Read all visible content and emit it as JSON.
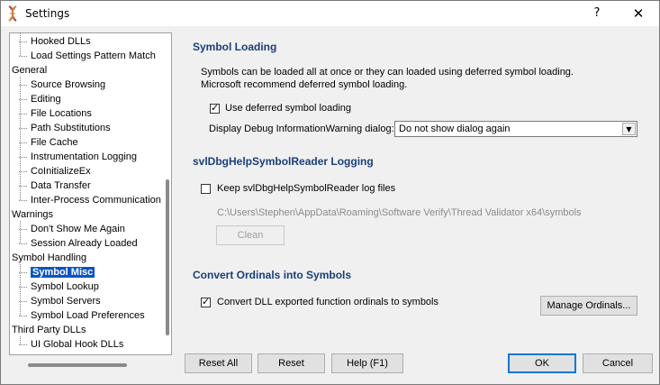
{
  "window": {
    "title": "Settings",
    "help_glyph": "?",
    "close_glyph": "✕"
  },
  "tree": {
    "items": [
      {
        "label": "Hooked DLLs",
        "level": 1
      },
      {
        "label": "Load Settings Pattern Match",
        "level": 1
      },
      {
        "label": "General",
        "level": 0
      },
      {
        "label": "Source Browsing",
        "level": 1
      },
      {
        "label": "Editing",
        "level": 1
      },
      {
        "label": "File Locations",
        "level": 1
      },
      {
        "label": "Path Substitutions",
        "level": 1
      },
      {
        "label": "File Cache",
        "level": 1
      },
      {
        "label": "Instrumentation Logging",
        "level": 1
      },
      {
        "label": "CoInitializeEx",
        "level": 1
      },
      {
        "label": "Data Transfer",
        "level": 1
      },
      {
        "label": "Inter-Process Communication",
        "level": 1
      },
      {
        "label": "Warnings",
        "level": 0
      },
      {
        "label": "Don't Show Me Again",
        "level": 1
      },
      {
        "label": "Session Already Loaded",
        "level": 1
      },
      {
        "label": "Symbol Handling",
        "level": 0
      },
      {
        "label": "Symbol Misc",
        "level": 1,
        "selected": true
      },
      {
        "label": "Symbol Lookup",
        "level": 1
      },
      {
        "label": "Symbol Servers",
        "level": 1
      },
      {
        "label": "Symbol Load Preferences",
        "level": 1
      },
      {
        "label": "Third Party DLLs",
        "level": 0
      },
      {
        "label": "UI Global Hook DLLs",
        "level": 1
      }
    ]
  },
  "symbol_loading": {
    "title": "Symbol Loading",
    "desc_line1": "Symbols can be loaded all at once or they can loaded using deferred symbol loading.",
    "desc_line2": "Microsoft recommend deferred symbol loading.",
    "use_deferred_label": "Use deferred symbol loading",
    "use_deferred_checked": true,
    "display_debug_label": "Display Debug InformationWarning dialog:",
    "display_debug_value": "Do not show dialog again"
  },
  "reader_logging": {
    "title": "svlDbgHelpSymbolReader Logging",
    "keep_log_label": "Keep svlDbgHelpSymbolReader log files",
    "keep_log_checked": false,
    "log_path": "C:\\Users\\Stephen\\AppData\\Roaming\\Software Verify\\Thread Validator x64\\symbols",
    "clean_label": "Clean"
  },
  "ordinals": {
    "title": "Convert Ordinals into Symbols",
    "convert_label": "Convert DLL exported function ordinals to symbols",
    "convert_checked": true,
    "manage_label": "Manage Ordinals..."
  },
  "footer": {
    "reset_all": "Reset All",
    "reset": "Reset",
    "help": "Help (F1)",
    "ok": "OK",
    "cancel": "Cancel"
  }
}
